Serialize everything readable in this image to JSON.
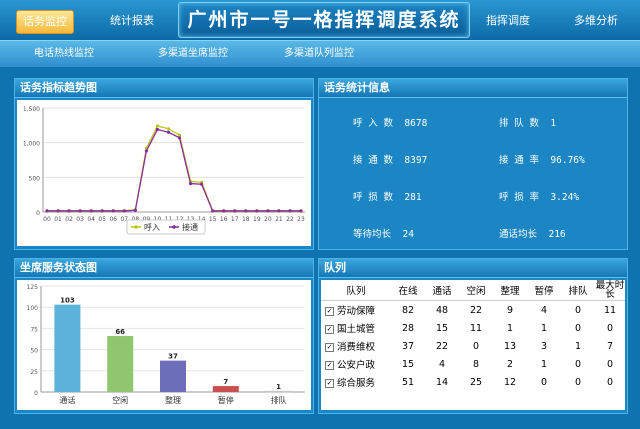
{
  "nav": {
    "home": "话务监控",
    "stats_report": "统计报表",
    "title": "广州市一号一格指挥调度系统",
    "dispatch": "指挥调度",
    "multi_analysis": "多维分析"
  },
  "subnav": {
    "tab1": "电话热线监控",
    "tab2": "多渠道坐席监控",
    "tab3": "多渠道队列监控"
  },
  "trend": {
    "title": "话务指标趋势图"
  },
  "stats": {
    "title": "话务统计信息",
    "call_in_label": "呼 入 数",
    "call_in": "8678",
    "queue_label": "排 队 数",
    "queue": "1",
    "answered_label": "接 通 数",
    "answered": "8397",
    "answer_rate_label": "接 通 率",
    "answer_rate": "96.76%",
    "lost_label": "呼 损 数",
    "lost": "281",
    "lost_rate_label": "呼 损 率",
    "lost_rate": "3.24%",
    "avg_wait_label": "等待均长",
    "avg_wait": "24",
    "avg_talk_label": "通话均长",
    "avg_talk": "216"
  },
  "agents": {
    "title": "坐席服务状态图"
  },
  "queue_panel": {
    "title": "队列",
    "headers": [
      "队列",
      "在线",
      "通话",
      "空闲",
      "整理",
      "暂停",
      "排队",
      "最大时长"
    ],
    "rows": [
      [
        "劳动保障",
        "82",
        "48",
        "22",
        "9",
        "4",
        "0",
        "11"
      ],
      [
        "国土城管",
        "28",
        "15",
        "11",
        "1",
        "1",
        "0",
        "0"
      ],
      [
        "消费维权",
        "37",
        "22",
        "0",
        "13",
        "3",
        "1",
        "7"
      ],
      [
        "公安户政",
        "15",
        "4",
        "8",
        "2",
        "1",
        "0",
        "0"
      ],
      [
        "综合服务",
        "51",
        "14",
        "25",
        "12",
        "0",
        "0",
        "0"
      ]
    ]
  },
  "chart_data": [
    {
      "type": "line",
      "title": "话务指标趋势图",
      "x": [
        "00",
        "01",
        "02",
        "03",
        "04",
        "05",
        "06",
        "07",
        "08",
        "09",
        "10",
        "11",
        "12",
        "13",
        "14",
        "15",
        "16",
        "17",
        "18",
        "19",
        "20",
        "21",
        "22",
        "23"
      ],
      "ylim": [
        0,
        1500
      ],
      "yticks": [
        "0",
        "500",
        "1,000",
        "1,500"
      ],
      "grid": true,
      "legend": "bottom",
      "series": [
        {
          "name": "呼入",
          "color": "#b8c81c",
          "values": [
            20,
            20,
            20,
            20,
            20,
            20,
            20,
            20,
            30,
            920,
            1240,
            1200,
            1110,
            440,
            430,
            20,
            20,
            20,
            20,
            20,
            20,
            20,
            20,
            20
          ]
        },
        {
          "name": "接通",
          "color": "#8b2d9c",
          "values": [
            15,
            15,
            15,
            15,
            15,
            15,
            15,
            15,
            25,
            880,
            1190,
            1150,
            1070,
            410,
            400,
            15,
            15,
            15,
            15,
            15,
            15,
            15,
            15,
            15
          ]
        }
      ]
    },
    {
      "type": "bar",
      "title": "坐席服务状态图",
      "categories": [
        "通话",
        "空闲",
        "整理",
        "暂停",
        "排队"
      ],
      "values": [
        103,
        66,
        37,
        7,
        1
      ],
      "colors": [
        "#5bb3d9",
        "#8fc66e",
        "#6c6fb8",
        "#c9524f",
        "#e8e8e8"
      ],
      "ylim": [
        0,
        125
      ],
      "yticks": [
        "0",
        "25",
        "50",
        "75",
        "100",
        "125"
      ]
    }
  ]
}
